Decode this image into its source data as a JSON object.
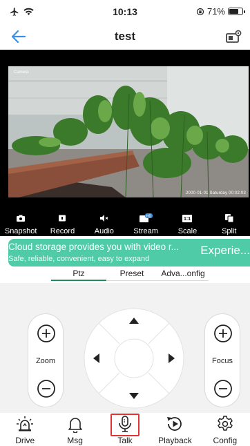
{
  "status_bar": {
    "time": "10:13",
    "battery": "71%",
    "battery_level": 0.71
  },
  "nav": {
    "title": "test",
    "back_icon": "back-arrow-icon",
    "device_icon": "device-settings-icon"
  },
  "video": {
    "osd_name": "Camera",
    "osd_timestamp": "2000-01-01 Saturday 00:02:03"
  },
  "toolbar": {
    "items": [
      {
        "label": "Snapshot",
        "icon": "camera-icon"
      },
      {
        "label": "Record",
        "icon": "video-record-icon"
      },
      {
        "label": "Audio",
        "icon": "speaker-muted-icon"
      },
      {
        "label": "Stream",
        "icon": "stream-quality-icon",
        "badge": "HD"
      },
      {
        "label": "Scale",
        "icon": "scale-icon",
        "badge": "1:1"
      },
      {
        "label": "Split",
        "icon": "split-screen-icon"
      }
    ]
  },
  "cloud_banner": {
    "title": "Cloud storage provides you with video r...",
    "subtitle": "Safe, reliable, convenient, easy to expand",
    "button": "Experie..."
  },
  "tabs": [
    {
      "label": "Ptz",
      "active": true
    },
    {
      "label": "Preset",
      "active": false
    },
    {
      "label": "Adva...onfig",
      "active": false
    }
  ],
  "ptz": {
    "zoom_label": "Zoom",
    "focus_label": "Focus"
  },
  "bottom_nav": [
    {
      "label": "Drive",
      "icon": "alarm-light-icon"
    },
    {
      "label": "Msg",
      "icon": "bell-icon"
    },
    {
      "label": "Talk",
      "icon": "microphone-icon",
      "highlighted": true
    },
    {
      "label": "Playback",
      "icon": "playback-icon"
    },
    {
      "label": "Config",
      "icon": "gear-icon"
    }
  ],
  "colors": {
    "accent": "#3a8ee6",
    "active_tab_underline": "#1f8a5a",
    "banner": "#4fcba8",
    "highlight": "#e03434"
  }
}
